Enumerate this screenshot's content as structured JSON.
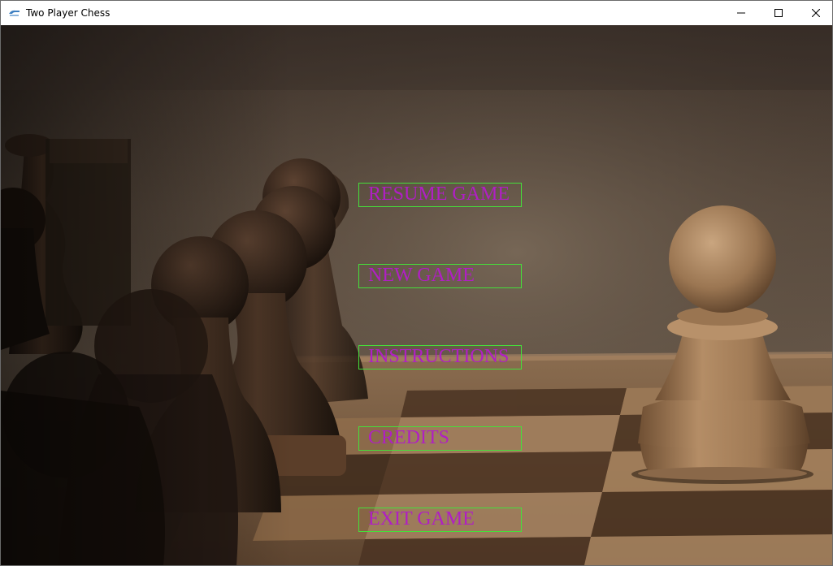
{
  "window": {
    "title": "Two Player Chess",
    "controls": {
      "minimize": "minimize-icon",
      "maximize": "maximize-icon",
      "close": "close-icon"
    }
  },
  "menu": {
    "items": [
      {
        "id": "resume",
        "label": "RESUME GAME"
      },
      {
        "id": "new",
        "label": "NEW GAME"
      },
      {
        "id": "instructions",
        "label": "INSTRUCTIONS"
      },
      {
        "id": "credits",
        "label": "CREDITS"
      },
      {
        "id": "exit",
        "label": "EXIT GAME"
      }
    ]
  },
  "colors": {
    "menu_text": "#b01fc4",
    "menu_border": "#45e03a",
    "background_tone": "#5a4a3c"
  }
}
